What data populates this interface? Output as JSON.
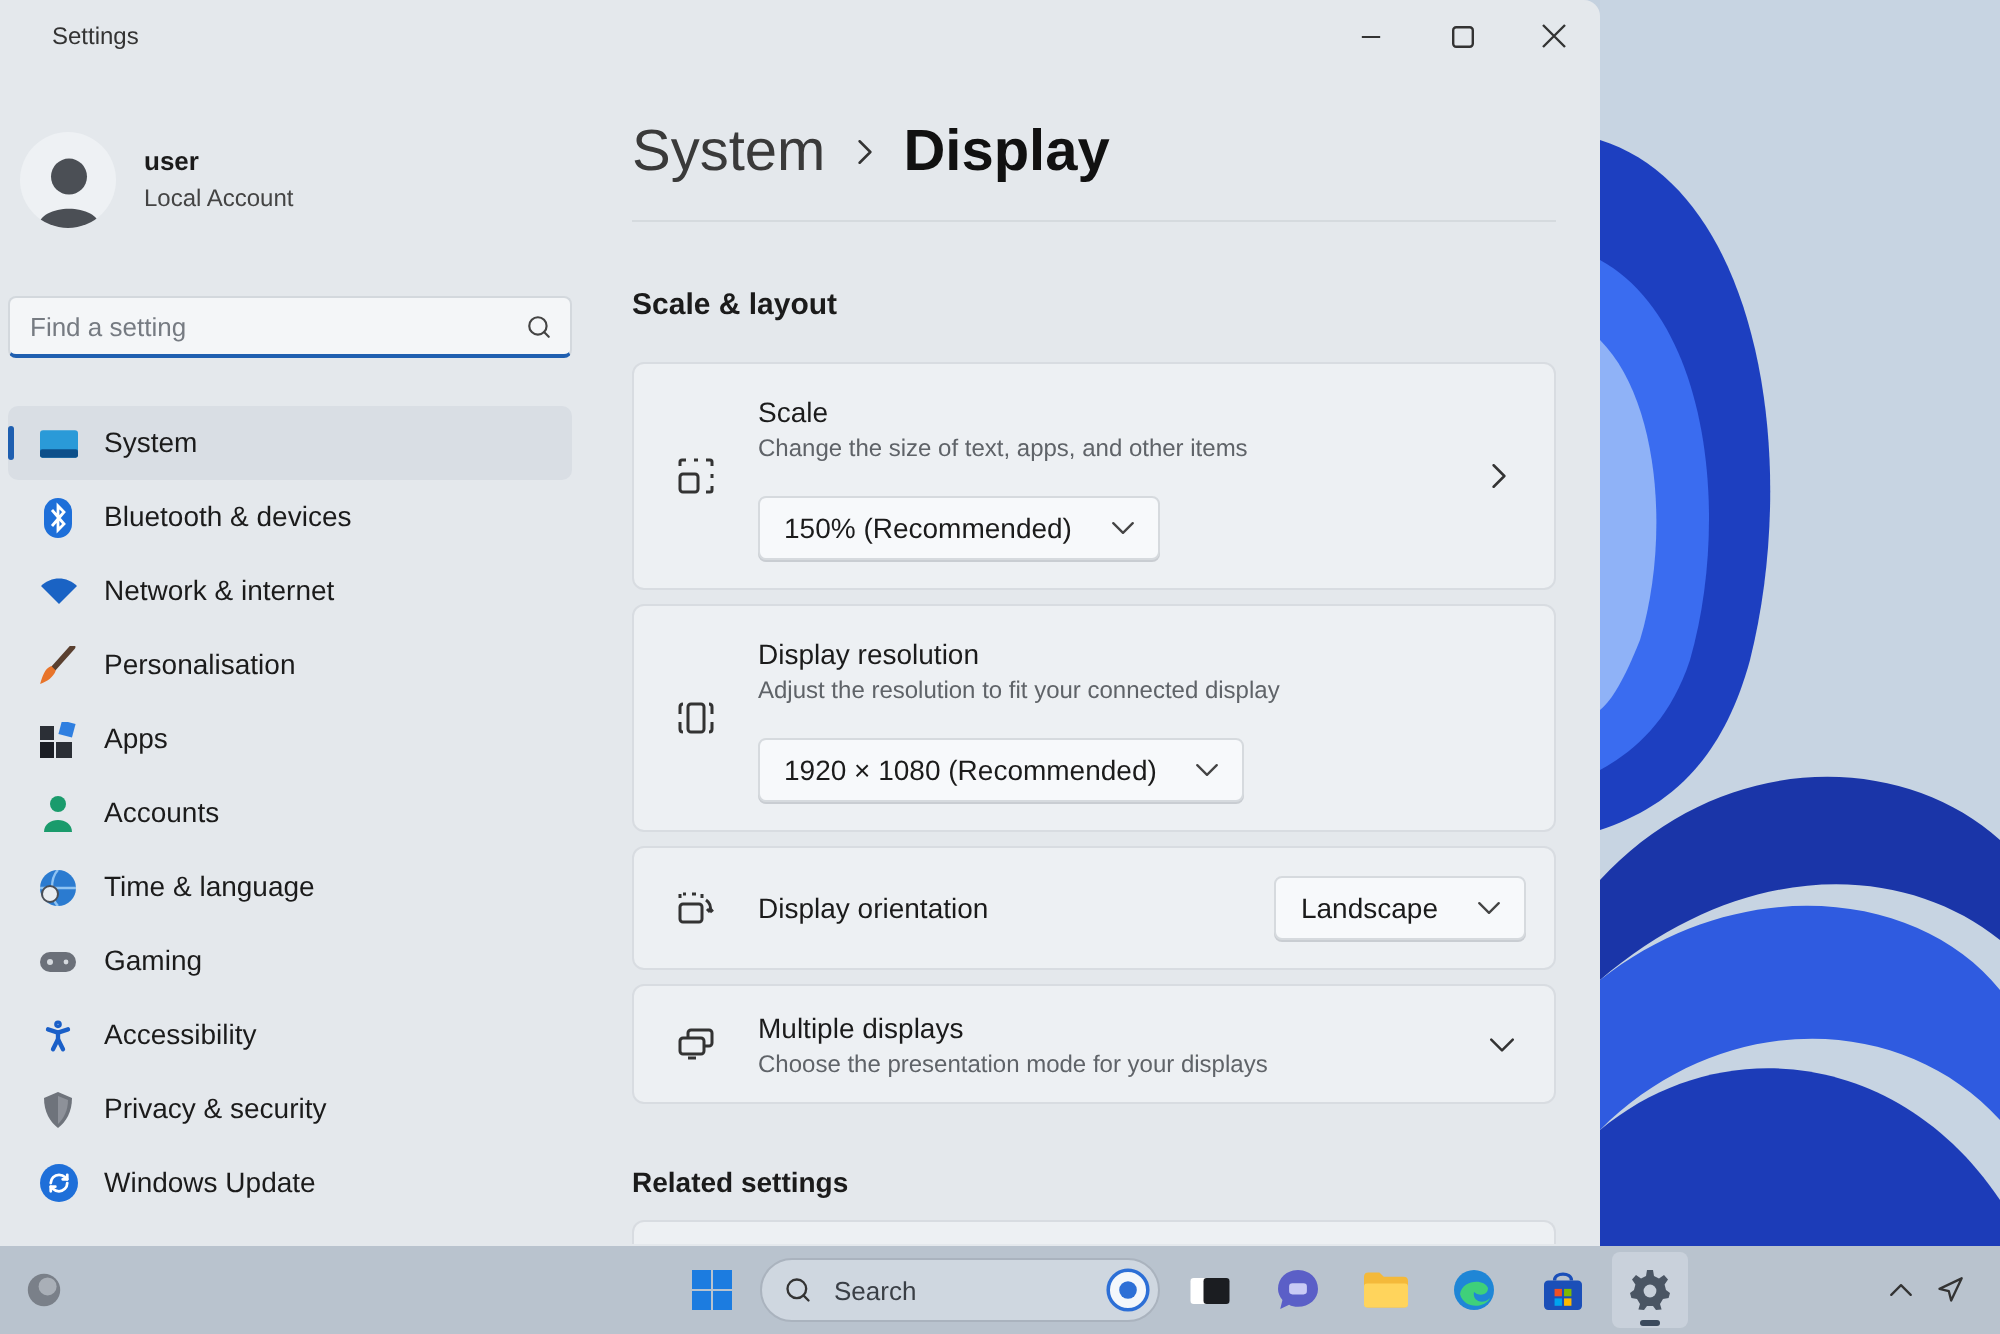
{
  "window": {
    "title": "Settings"
  },
  "profile": {
    "name": "user",
    "account_type": "Local Account"
  },
  "search": {
    "placeholder": "Find a setting"
  },
  "sidebar": {
    "items": [
      {
        "label": "System",
        "selected": true
      },
      {
        "label": "Bluetooth & devices",
        "selected": false
      },
      {
        "label": "Network & internet",
        "selected": false
      },
      {
        "label": "Personalisation",
        "selected": false
      },
      {
        "label": "Apps",
        "selected": false
      },
      {
        "label": "Accounts",
        "selected": false
      },
      {
        "label": "Time & language",
        "selected": false
      },
      {
        "label": "Gaming",
        "selected": false
      },
      {
        "label": "Accessibility",
        "selected": false
      },
      {
        "label": "Privacy & security",
        "selected": false
      },
      {
        "label": "Windows Update",
        "selected": false
      }
    ]
  },
  "breadcrumb": [
    "System",
    "Display"
  ],
  "scale_layout": {
    "title": "Scale & layout",
    "cards": [
      {
        "kind": "nav",
        "title": "Scale",
        "description": "Change the size of text, apps, and other items",
        "dropdown": "150% (Recommended)"
      },
      {
        "kind": "stacked",
        "title": "Display resolution",
        "description": "Adjust the resolution to fit your connected display",
        "dropdown": "1920 × 1080 (Recommended)"
      },
      {
        "kind": "inline",
        "title": "Display orientation",
        "dropdown": "Landscape"
      },
      {
        "kind": "expander",
        "title": "Multiple displays",
        "description": "Choose the presentation mode for your displays",
        "expanded": false
      }
    ]
  },
  "related_settings": {
    "title": "Related settings"
  },
  "taskbar": {
    "search": {
      "placeholder": "Search"
    },
    "apps": [
      {
        "active": false
      },
      {
        "active": false
      },
      {
        "active": false
      },
      {
        "active": false
      },
      {
        "active": false
      },
      {
        "active": true
      }
    ]
  }
}
